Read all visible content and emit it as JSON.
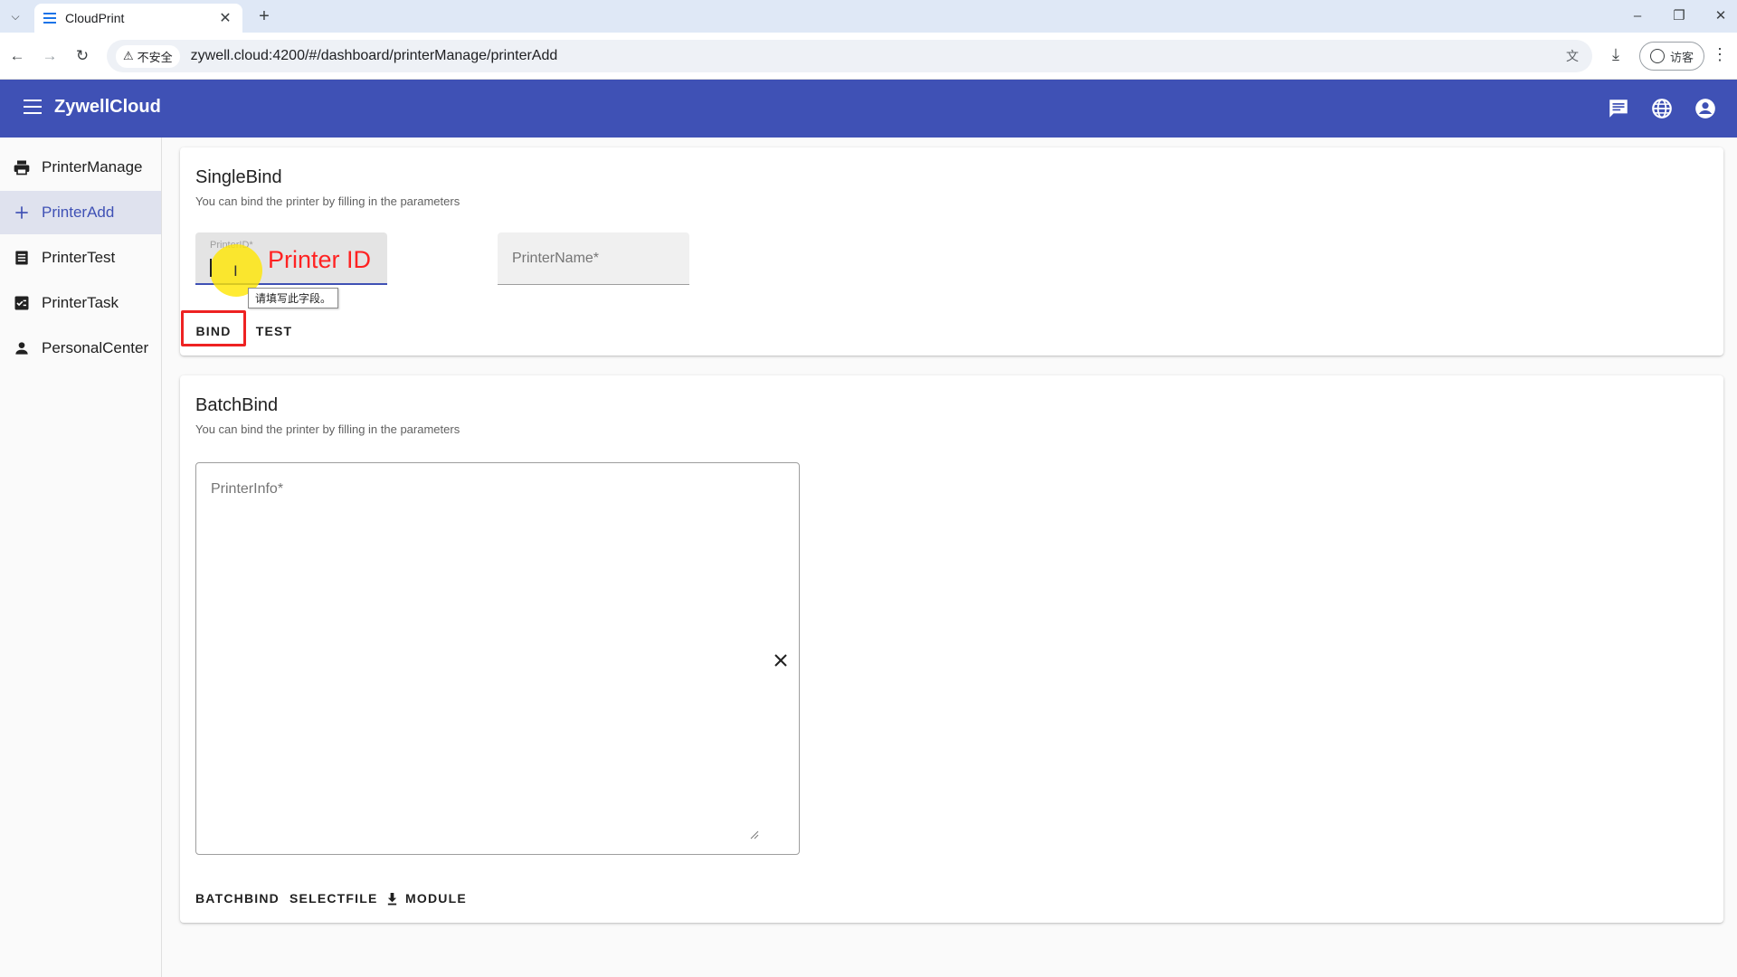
{
  "browser": {
    "tab_title": "CloudPrint",
    "security_label": "不安全",
    "url": "zywell.cloud:4200/#/dashboard/printerManage/printerAdd",
    "guest_label": "访客"
  },
  "app": {
    "title": "ZywellCloud",
    "brand_color": "#3f51b5"
  },
  "sidebar": {
    "items": [
      {
        "label": "PrinterManage",
        "icon": "printer-icon"
      },
      {
        "label": "PrinterAdd",
        "icon": "add-icon"
      },
      {
        "label": "PrinterTest",
        "icon": "document-list-icon"
      },
      {
        "label": "PrinterTask",
        "icon": "task-check-icon"
      },
      {
        "label": "PersonalCenter",
        "icon": "person-icon"
      }
    ],
    "active": "PrinterAdd"
  },
  "single_bind": {
    "title": "SingleBind",
    "subtitle": "You can bind the printer by filling in the parameters",
    "printer_id_label": "PrinterID*",
    "printer_name_placeholder": "PrinterName*",
    "bind_label": "BIND",
    "test_label": "TEST",
    "validation_tooltip": "请填写此字段。"
  },
  "batch_bind": {
    "title": "BatchBind",
    "subtitle": "You can bind the printer by filling in the parameters",
    "printer_info_label": "PrinterInfo*",
    "batchbind_label": "BATCHBIND",
    "selectfile_label": "SELECTFILE",
    "module_label": "MODULE"
  },
  "annotation": {
    "text": "Printer ID",
    "color": "#ff2222"
  }
}
